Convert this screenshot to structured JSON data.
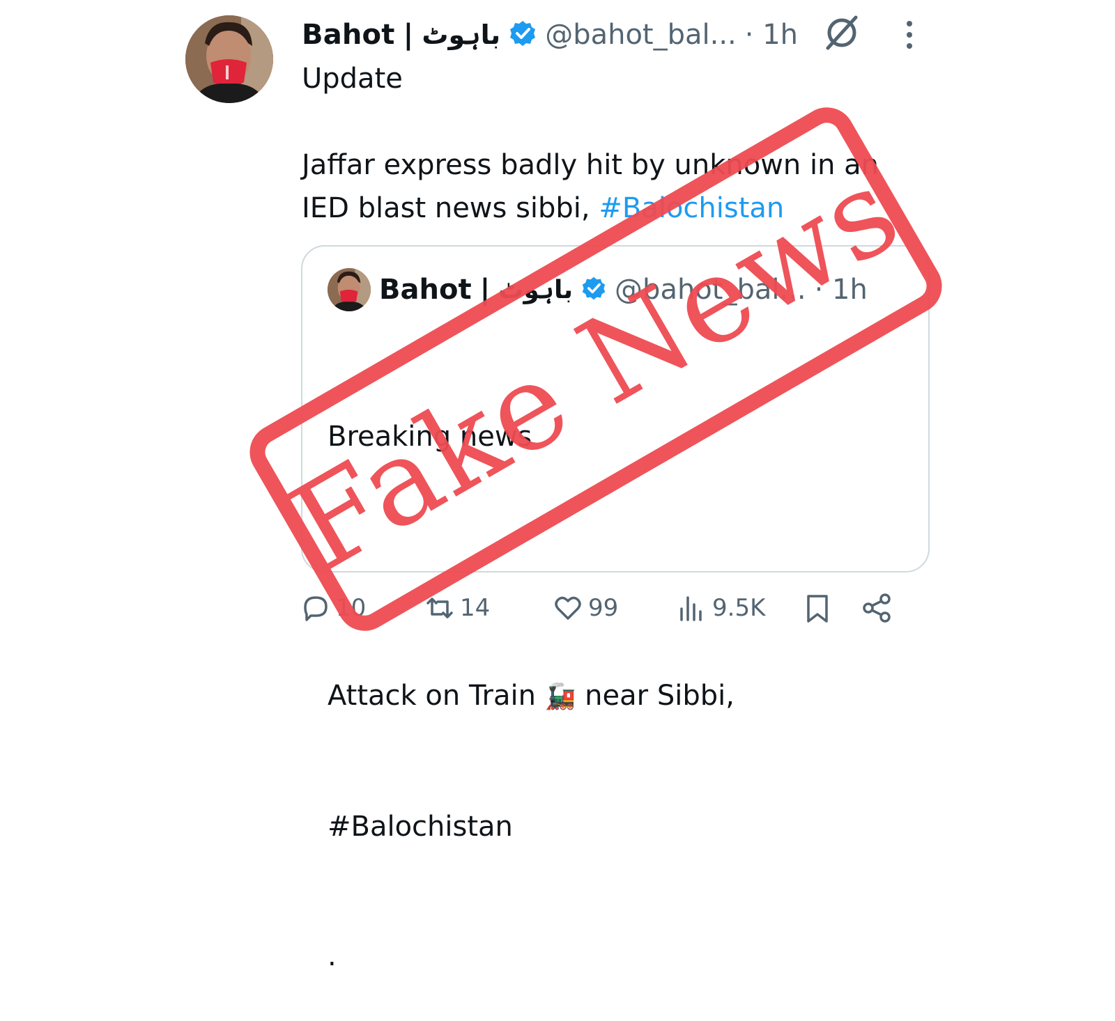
{
  "tweet": {
    "author_name": "Bahot",
    "separator": "|",
    "author_name_urdu": "باہوٹ",
    "handle": "@bahot_bal...",
    "time": "· 1h",
    "text_lines": [
      "Update",
      "",
      "Jaffar express badly hit by unknown in an",
      "IED blast news sibbi, "
    ],
    "hashtag": "#Balochistan"
  },
  "quote": {
    "author_name": "Bahot",
    "separator": "|",
    "author_name_urdu": "باہوٹ",
    "handle": "@bahot_bal...",
    "time": "· 1h",
    "line1": "Breaking news",
    "line2_prefix": "Attack on Train ",
    "train_emoji": "🚂",
    "line2_suffix": " near Sibbi,",
    "line3": "#Balochistan",
    "line4": "."
  },
  "actions": {
    "replies": "10",
    "reposts": "14",
    "likes": "99",
    "views": "9.5K"
  },
  "stamp": {
    "text": "Fake News",
    "color": "#ee4b52"
  },
  "colors": {
    "link": "#1d9bf0",
    "secondary_text": "#536471",
    "verified": "#1d9bf0"
  },
  "icons": [
    "verified-badge-icon",
    "grok-icon",
    "more-icon",
    "reply-icon",
    "repost-icon",
    "like-icon",
    "views-icon",
    "bookmark-icon",
    "share-icon"
  ]
}
